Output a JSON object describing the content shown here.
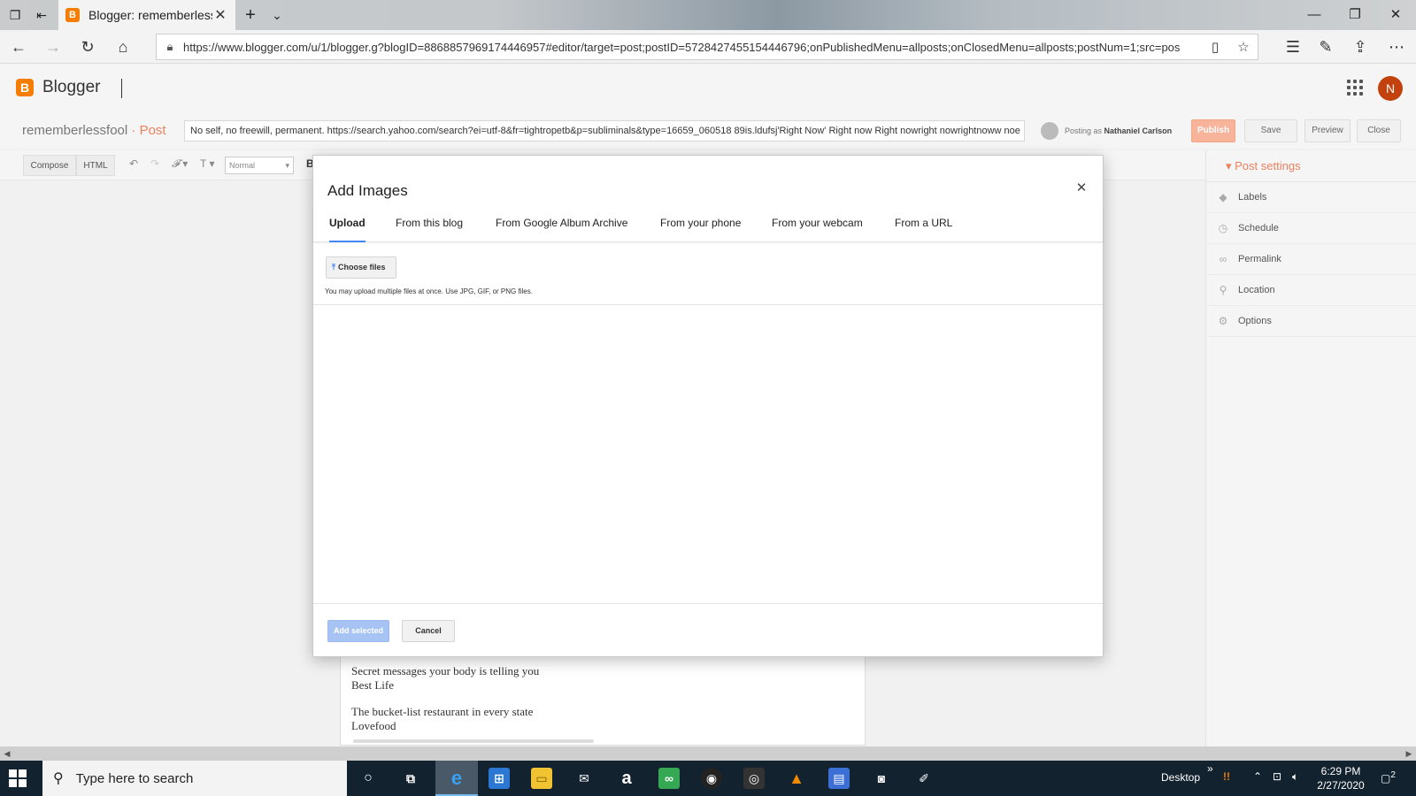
{
  "browser": {
    "tab_title": "Blogger: rememberlessf",
    "url": "https://www.blogger.com/u/1/blogger.g?blogID=8868857969174446957#editor/target=post;postID=5728427455154446796;onPublishedMenu=allposts;onClosedMenu=allposts;postNum=1;src=pos"
  },
  "header": {
    "app_name": "Blogger",
    "avatar_letter": "N"
  },
  "postbar": {
    "blog_name": "rememberlessfool",
    "separator": "·",
    "section": "Post",
    "post_title": "No self, no freewill, permanent. https://search.yahoo.com/search?ei=utf-8&fr=tightropetb&p=subliminals&type=16659_060518 89is.ldufsj'Right Now' Right now Right nowright nowrightnoww noe",
    "posting_as_label": "Posting as",
    "posting_as_name": "Nathaniel Carlson",
    "publish": "Publish",
    "save": "Save",
    "preview": "Preview",
    "close": "Close"
  },
  "toolbar": {
    "compose": "Compose",
    "html": "HTML",
    "format": "Normal",
    "bold": "B"
  },
  "editor": {
    "lines": [
      "Secret messages your body is telling you",
      "Best Life",
      "The bucket-list restaurant in every state",
      "Lovefood"
    ]
  },
  "sidebar": {
    "title": "Post settings",
    "items": [
      "Labels",
      "Schedule",
      "Permalink",
      "Location",
      "Options"
    ]
  },
  "modal": {
    "title": "Add Images",
    "tabs": [
      "Upload",
      "From this blog",
      "From Google Album Archive",
      "From your phone",
      "From your webcam",
      "From a URL"
    ],
    "choose_files": "Choose files",
    "hint": "You may upload multiple files at once. Use JPG, GIF, or PNG files.",
    "add_selected": "Add selected",
    "cancel": "Cancel"
  },
  "taskbar": {
    "search_placeholder": "Type here to search",
    "desktop_label": "Desktop",
    "time": "6:29 PM",
    "date": "2/27/2020",
    "notification_count": "2"
  },
  "colors": {
    "blogger_orange": "#f57d00",
    "accent_blue": "#4285f4",
    "publish_button": "#f7b49a",
    "taskbar": "#13222f"
  }
}
